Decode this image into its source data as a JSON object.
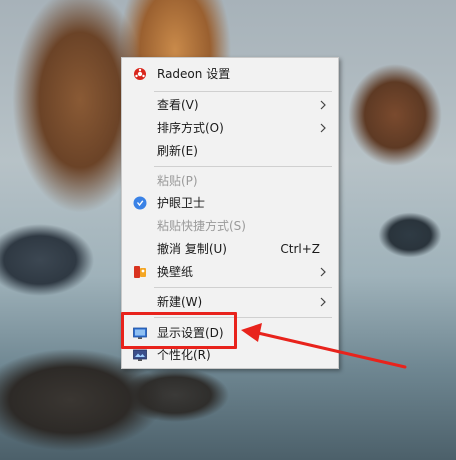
{
  "menu": {
    "items": [
      {
        "label": "Radeon 设置",
        "icon": "radeon-logo-icon"
      },
      {
        "label": "查看(V)",
        "has_submenu": true
      },
      {
        "label": "排序方式(O)",
        "has_submenu": true
      },
      {
        "label": "刷新(E)"
      },
      {
        "label": "粘贴(P)",
        "disabled": true
      },
      {
        "label": "护眼卫士",
        "icon": "eye-guard-icon"
      },
      {
        "label": "粘贴快捷方式(S)",
        "disabled": true
      },
      {
        "label": "撤消 复制(U)",
        "shortcut": "Ctrl+Z"
      },
      {
        "label": "换壁纸",
        "icon": "wallpaper-icon",
        "has_submenu": true
      },
      {
        "label": "新建(W)",
        "has_submenu": true
      },
      {
        "label": "显示设置(D)",
        "icon": "display-settings-icon"
      },
      {
        "label": "个性化(R)",
        "icon": "personalize-icon"
      }
    ]
  },
  "colors": {
    "annotation_red": "#e8231c",
    "menu_background": "#f2f2f2",
    "disabled_text": "#9a9a9a"
  }
}
